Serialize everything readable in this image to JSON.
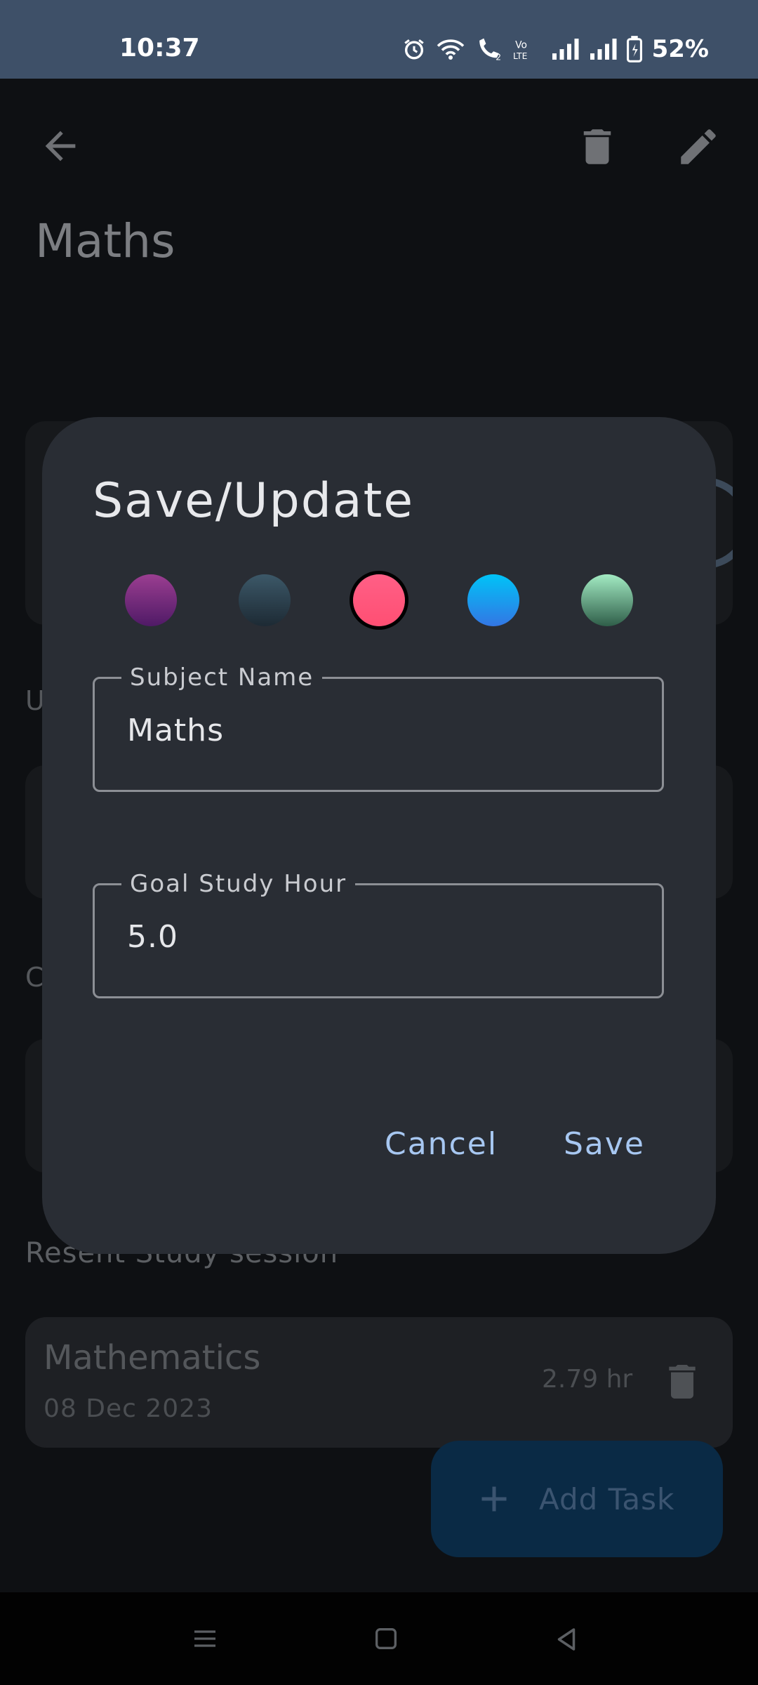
{
  "status_bar": {
    "time": "10:37",
    "battery": "52%",
    "icons": [
      "alarm-icon",
      "wifi-icon",
      "wifi-call-icon",
      "volte-icon",
      "signal-icon",
      "signal-icon",
      "battery-icon"
    ]
  },
  "toolbar": {
    "back_icon": "arrow-back-icon",
    "delete_icon": "trash-icon",
    "edit_icon": "pencil-icon"
  },
  "subject": {
    "title": "Maths"
  },
  "background": {
    "section_1_initial": "U",
    "section_2_initial": "C",
    "recent_label": "Resent Study session",
    "session": {
      "title": "Mathematics",
      "date": "08 Dec 2023",
      "duration": "2.79 hr"
    },
    "fab_label": "Add Task"
  },
  "dialog": {
    "title": "Save/Update",
    "colors": [
      {
        "name": "purple",
        "top": "#9b3e91",
        "bottom": "#4f1a66"
      },
      {
        "name": "slate",
        "top": "#3c5868",
        "bottom": "#1d2a34"
      },
      {
        "name": "pink",
        "top": "#ff5f86",
        "bottom": "#ff4f73"
      },
      {
        "name": "blue",
        "top": "#00c3f7",
        "bottom": "#3376e4"
      },
      {
        "name": "mint",
        "top": "#a3ebc3",
        "bottom": "#2f5e49"
      }
    ],
    "selected_color": "pink",
    "subject_name_label": "Subject Name",
    "subject_name_value": "Maths",
    "goal_label": "Goal Study Hour",
    "goal_value": "5.0",
    "cancel_label": "Cancel",
    "save_label": "Save"
  }
}
